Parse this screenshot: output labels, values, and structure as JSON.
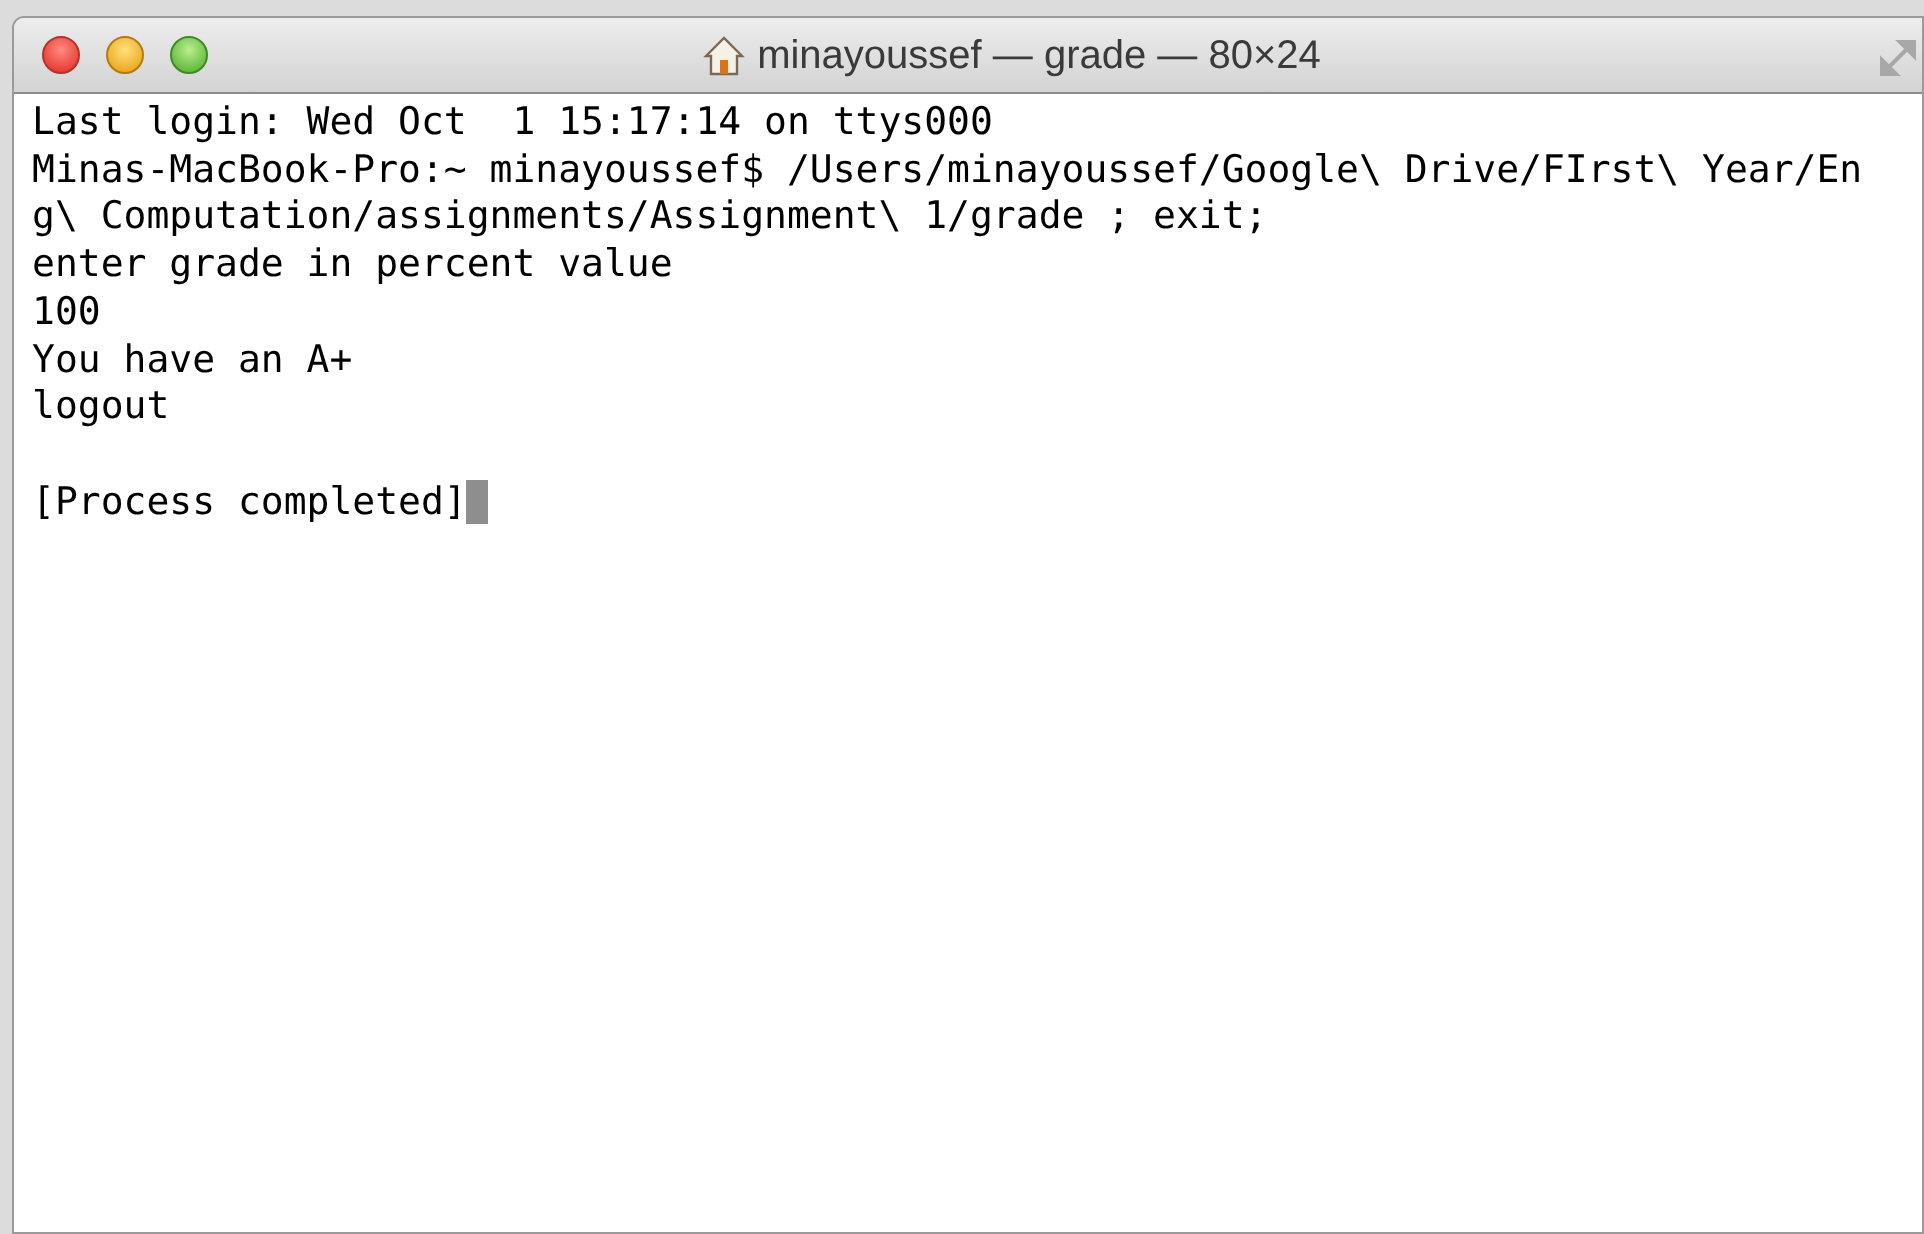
{
  "window": {
    "title": "minayoussef — grade — 80×24"
  },
  "lines": [
    "Last login: Wed Oct  1 15:17:14 on ttys000",
    "Minas-MacBook-Pro:~ minayoussef$ /Users/minayoussef/Google\\ Drive/FIrst\\ Year/En",
    "g\\ Computation/assignments/Assignment\\ 1/grade ; exit;",
    "enter grade in percent value",
    "100",
    "You have an A+",
    "logout"
  ],
  "status_line": {
    "text": "[Process completed]",
    "cursor": true
  }
}
